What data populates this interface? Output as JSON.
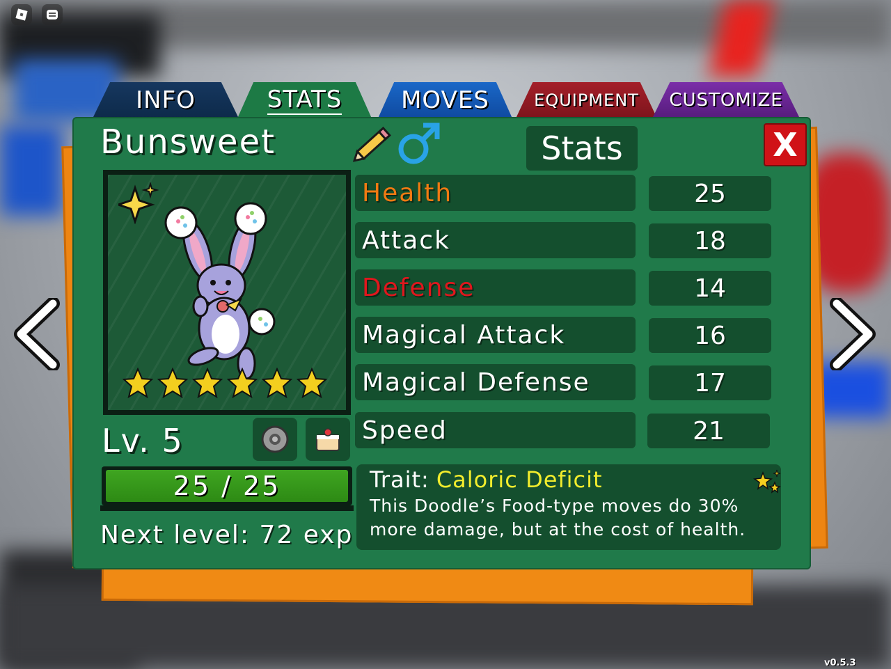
{
  "tabs": [
    {
      "label": "INFO"
    },
    {
      "label": "STATS",
      "active": true
    },
    {
      "label": "MOVES"
    },
    {
      "label": "EQUIPMENT"
    },
    {
      "label": "CUSTOMIZE"
    }
  ],
  "doodle": {
    "name": "Bunsweet",
    "gender_icon": "male-icon",
    "rarity_stars": 6,
    "level": "Lv. 5",
    "hp_text": "25 / 25",
    "hp_current": 25,
    "hp_max": 25,
    "next_level": "Next level: 72 exp"
  },
  "panel": {
    "title": "Stats",
    "close_label": "X"
  },
  "stats": [
    {
      "label": "Health",
      "value": "25",
      "color": "#f07a12"
    },
    {
      "label": "Attack",
      "value": "18",
      "color": "#ffffff"
    },
    {
      "label": "Defense",
      "value": "14",
      "color": "#e0171d"
    },
    {
      "label": "Magical Attack",
      "value": "16",
      "color": "#ffffff"
    },
    {
      "label": "Magical Defense",
      "value": "17",
      "color": "#ffffff"
    },
    {
      "label": "Speed",
      "value": "21",
      "color": "#ffffff"
    }
  ],
  "trait": {
    "prefix": "Trait:",
    "name": "Caloric Deficit",
    "description": "This Doodle’s Food-type moves do 30% more damage, but at the cost of health."
  },
  "items": [
    "disc-icon",
    "cake-icon"
  ],
  "version": "v0.5.3",
  "colors": {
    "panel": "#207a4a",
    "panel_dark": "#144f2e",
    "paper": "#f08a14",
    "trait_name": "#f1ec2d",
    "close": "#d01217"
  }
}
